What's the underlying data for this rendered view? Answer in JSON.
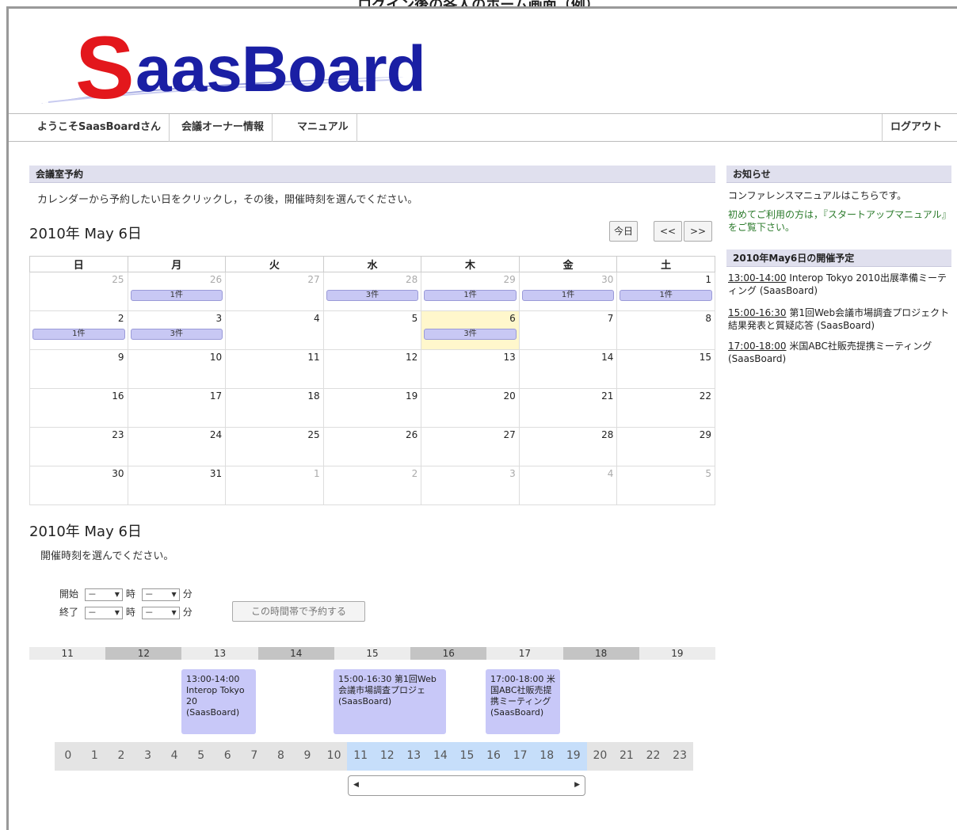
{
  "caption": "ログイン後の各人のホーム画面（例）",
  "logo": {
    "text_s": "S",
    "text_rest": "aasBoard"
  },
  "nav": {
    "welcome": "ようこそSaasBoardさん",
    "owner_info": "会議オーナー情報",
    "manual": "マニュアル",
    "logout": "ログアウト"
  },
  "reservation": {
    "header": "会議室予約",
    "instruction": "カレンダーから予約したい日をクリックし，その後，開催時刻を選んでください。",
    "date_title": "2010年 May 6日",
    "today_button": "今日",
    "prev_button": "<<",
    "next_button": ">>"
  },
  "calendar": {
    "weekdays": [
      "日",
      "月",
      "火",
      "水",
      "木",
      "金",
      "土"
    ],
    "weeks": [
      [
        {
          "d": "25",
          "o": true
        },
        {
          "d": "26",
          "o": true
        },
        {
          "d": "27",
          "o": true
        },
        {
          "d": "28",
          "o": true
        },
        {
          "d": "29",
          "o": true
        },
        {
          "d": "30",
          "o": true
        },
        {
          "d": "1",
          "o": false
        }
      ],
      [
        {
          "d": "2",
          "o": false
        },
        {
          "d": "3",
          "o": false
        },
        {
          "d": "4",
          "o": false
        },
        {
          "d": "5",
          "o": false
        },
        {
          "d": "6",
          "o": false
        },
        {
          "d": "7",
          "o": false
        },
        {
          "d": "8",
          "o": false
        }
      ],
      [
        {
          "d": "9",
          "o": false
        },
        {
          "d": "10",
          "o": false
        },
        {
          "d": "11",
          "o": false
        },
        {
          "d": "12",
          "o": false
        },
        {
          "d": "13",
          "o": false
        },
        {
          "d": "14",
          "o": false
        },
        {
          "d": "15",
          "o": false
        }
      ],
      [
        {
          "d": "16",
          "o": false
        },
        {
          "d": "17",
          "o": false
        },
        {
          "d": "18",
          "o": false
        },
        {
          "d": "19",
          "o": false
        },
        {
          "d": "20",
          "o": false
        },
        {
          "d": "21",
          "o": false
        },
        {
          "d": "22",
          "o": false
        }
      ],
      [
        {
          "d": "23",
          "o": false
        },
        {
          "d": "24",
          "o": false
        },
        {
          "d": "25",
          "o": false
        },
        {
          "d": "26",
          "o": false
        },
        {
          "d": "27",
          "o": false
        },
        {
          "d": "28",
          "o": false
        },
        {
          "d": "29",
          "o": false
        }
      ],
      [
        {
          "d": "30",
          "o": false
        },
        {
          "d": "31",
          "o": false
        },
        {
          "d": "1",
          "o": true
        },
        {
          "d": "2",
          "o": true
        },
        {
          "d": "3",
          "o": true
        },
        {
          "d": "4",
          "o": true
        },
        {
          "d": "5",
          "o": true
        }
      ]
    ],
    "counts": {
      "0-1": "1件",
      "0-3": "3件",
      "0-4": "1件",
      "0-5": "1件",
      "0-6": "1件",
      "1-0": "1件",
      "1-1": "3件",
      "1-4": "3件"
    }
  },
  "news": {
    "header": "お知らせ",
    "line1": "コンファレンスマニュアルはこちらです。",
    "line2": "初めてご利用の方は，『スタートアップマニュアル』をご覧下さい。"
  },
  "schedule": {
    "header": "2010年May6日の開催予定",
    "items": [
      {
        "time": "13:00-14:00",
        "text": " Interop Tokyo 2010出展準備ミーティング (SaasBoard)"
      },
      {
        "time": "15:00-16:30",
        "text": " 第1回Web会議市場調査プロジェクト結果発表と質疑応答 (SaasBoard)"
      },
      {
        "time": "17:00-18:00",
        "text": " 米国ABC社販売提携ミーティング (SaasBoard)"
      }
    ]
  },
  "time_select": {
    "date_title": "2010年 May 6日",
    "instruction": "開催時刻を選んでください。",
    "start_label": "開始",
    "end_label": "終了",
    "hour_label": "時",
    "min_label": "分",
    "blank": "－",
    "reserve_button": "この時間帯で予約する"
  },
  "timeline": {
    "hours": [
      "11",
      "12",
      "13",
      "14",
      "15",
      "16",
      "17",
      "18",
      "19"
    ],
    "events": [
      {
        "text": "13:00-14:00 Interop Tokyo 20 (SaasBoard)"
      },
      {
        "text": "15:00-16:30 第1回Web会議市場調査プロジェ (SaasBoard)"
      },
      {
        "text": "17:00-18:00 米国ABC社販売提携ミーティング (SaasBoard)"
      }
    ],
    "day_hours": [
      "0",
      "1",
      "2",
      "3",
      "4",
      "5",
      "6",
      "7",
      "8",
      "9",
      "10",
      "11",
      "12",
      "13",
      "14",
      "15",
      "16",
      "17",
      "18",
      "19",
      "20",
      "21",
      "22",
      "23"
    ]
  }
}
